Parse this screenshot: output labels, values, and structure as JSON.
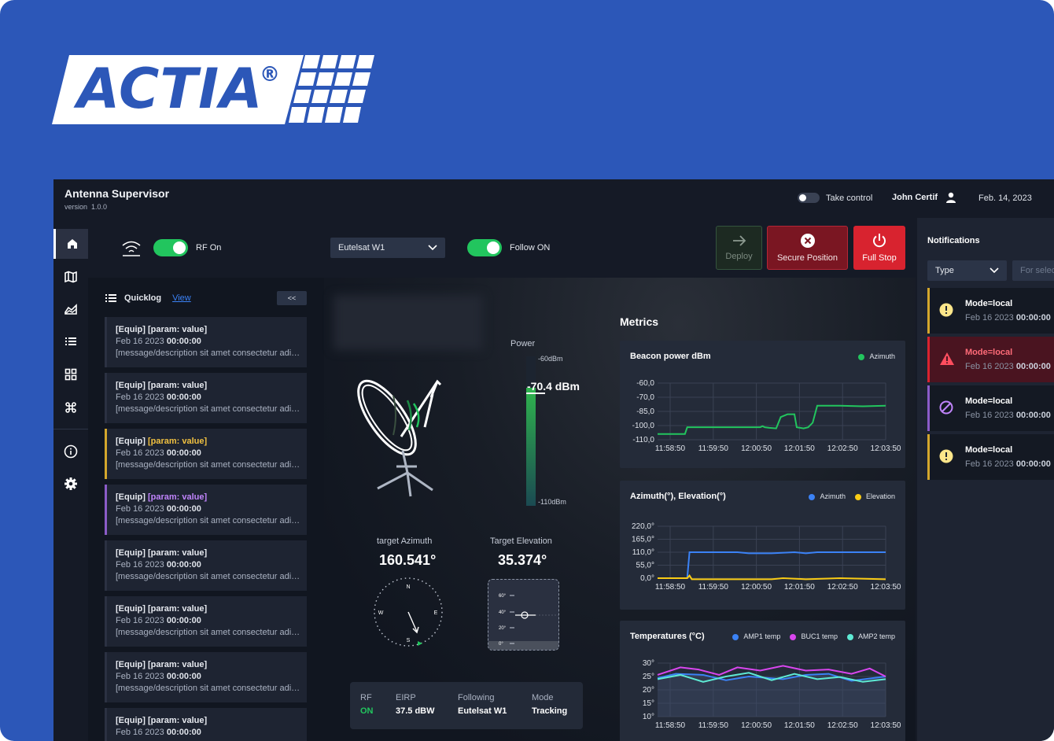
{
  "brand": {
    "name": "ACTIA",
    "reg": "®"
  },
  "header": {
    "title": "Antenna Supervisor",
    "version_label": "version",
    "version": "1.0.0",
    "take_control": "Take control",
    "user": "John Certif",
    "date": "Feb. 14, 2023"
  },
  "controls": {
    "rf_label": "RF On",
    "rf_on": true,
    "satellite": "Eutelsat W1",
    "follow_label": "Follow ON",
    "follow_on": true,
    "deploy": "Deploy",
    "secure": "Secure Position",
    "full_stop": "Full Stop"
  },
  "quicklog": {
    "title": "Quicklog",
    "view": "View",
    "collapse": "<<",
    "items": [
      {
        "equip": "[Equip]",
        "param": "[param: value]",
        "date": "Feb 16 2023",
        "time": "00:00:00",
        "msg": "[message/description sit amet consectetur adipiscing]",
        "level": "normal"
      },
      {
        "equip": "[Equip]",
        "param": "[param: value]",
        "date": "Feb 16 2023",
        "time": "00:00:00",
        "msg": "[message/description sit amet consectetur adipiscing]",
        "level": "normal"
      },
      {
        "equip": "[Equip]",
        "param": "[param: value]",
        "date": "Feb 16 2023",
        "time": "00:00:00",
        "msg": "[message/description sit amet consectetur adipiscing]",
        "level": "warn"
      },
      {
        "equip": "[Equip]",
        "param": "[param: value]",
        "date": "Feb 16 2023",
        "time": "00:00:00",
        "msg": "[message/description sit amet consectetur adipiscing]",
        "level": "purple"
      },
      {
        "equip": "[Equip]",
        "param": "[param: value]",
        "date": "Feb 16 2023",
        "time": "00:00:00",
        "msg": "[message/description sit amet consectetur adipiscing]",
        "level": "normal"
      },
      {
        "equip": "[Equip]",
        "param": "[param: value]",
        "date": "Feb 16 2023",
        "time": "00:00:00",
        "msg": "[message/description sit amet consectetur adipiscing]",
        "level": "normal"
      },
      {
        "equip": "[Equip]",
        "param": "[param: value]",
        "date": "Feb 16 2023",
        "time": "00:00:00",
        "msg": "[message/description sit amet consectetur adipiscing]",
        "level": "normal"
      },
      {
        "equip": "[Equip]",
        "param": "[param: value]",
        "date": "Feb 16 2023",
        "time": "00:00:00",
        "msg": "",
        "level": "normal"
      }
    ]
  },
  "antenna": {
    "power_label": "Power",
    "power_max": "-60dBm",
    "power_min": "-110dBm",
    "power_value": "-70.4 dBm",
    "power_fraction": 0.79,
    "target_azimuth_label": "target Azimuth",
    "target_azimuth": "160.541°",
    "target_elevation_label": "Target Elevation",
    "target_elevation": "35.374°",
    "compass": {
      "n": "N",
      "e": "E",
      "s": "S",
      "w": "W"
    },
    "elevation_scale": [
      "60°",
      "40°",
      "20°",
      "0°"
    ]
  },
  "status": [
    {
      "key": "RF",
      "value": "ON",
      "color": "#22c55e"
    },
    {
      "key": "EIRP",
      "value": "37.5 dBW",
      "color": "#ffffff"
    },
    {
      "key": "Following",
      "value": "Eutelsat W1",
      "color": "#ffffff"
    },
    {
      "key": "Mode",
      "value": "Tracking",
      "color": "#ffffff"
    }
  ],
  "metrics": {
    "title": "Metrics",
    "charts": [
      {
        "title": "Beacon power dBm",
        "legend": [
          {
            "name": "Azimuth",
            "color": "#22c55e"
          }
        ],
        "y_ticks": [
          "-60,0",
          "-70,0",
          "-85,0",
          "-100,0",
          "-110,0"
        ],
        "x_ticks": [
          "11:58:50",
          "11:59:50",
          "12:00:50",
          "12:01:50",
          "12:02:50",
          "12:03:50"
        ]
      },
      {
        "title": "Azimuth(°), Elevation(°)",
        "legend": [
          {
            "name": "Azimuth",
            "color": "#3b82f6"
          },
          {
            "name": "Elevation",
            "color": "#facc15"
          }
        ],
        "y_ticks": [
          "220,0°",
          "165,0°",
          "110,0°",
          "55,0°",
          "0,0°"
        ],
        "x_ticks": [
          "11:58:50",
          "11:59:50",
          "12:00:50",
          "12:01:50",
          "12:02:50",
          "12:03:50"
        ]
      },
      {
        "title": "Temperatures (°C)",
        "legend": [
          {
            "name": "AMP1 temp",
            "color": "#3b82f6"
          },
          {
            "name": "BUC1 temp",
            "color": "#d946ef"
          },
          {
            "name": "AMP2 temp",
            "color": "#5eead4"
          }
        ],
        "y_ticks": [
          "30°",
          "25°",
          "20°",
          "15°",
          "10°"
        ],
        "x_ticks": [
          "11:58:50",
          "11:59:50",
          "12:00:50",
          "12:01:50",
          "12:02:50",
          "12:03:50"
        ]
      }
    ]
  },
  "notifications": {
    "title": "Notifications",
    "type_filter": "Type",
    "search_placeholder": "For select...",
    "items": [
      {
        "title": "Mode=local",
        "date": "Feb 16 2023",
        "time": "00:00:00",
        "kind": "warning"
      },
      {
        "title": "Mode=local",
        "date": "Feb 16 2023",
        "time": "00:00:00",
        "kind": "error"
      },
      {
        "title": "Mode=local",
        "date": "Feb 16 2023",
        "time": "00:00:00",
        "kind": "blocked"
      },
      {
        "title": "Mode=local",
        "date": "Feb 16 2023",
        "time": "00:00:00",
        "kind": "warning"
      }
    ]
  }
}
